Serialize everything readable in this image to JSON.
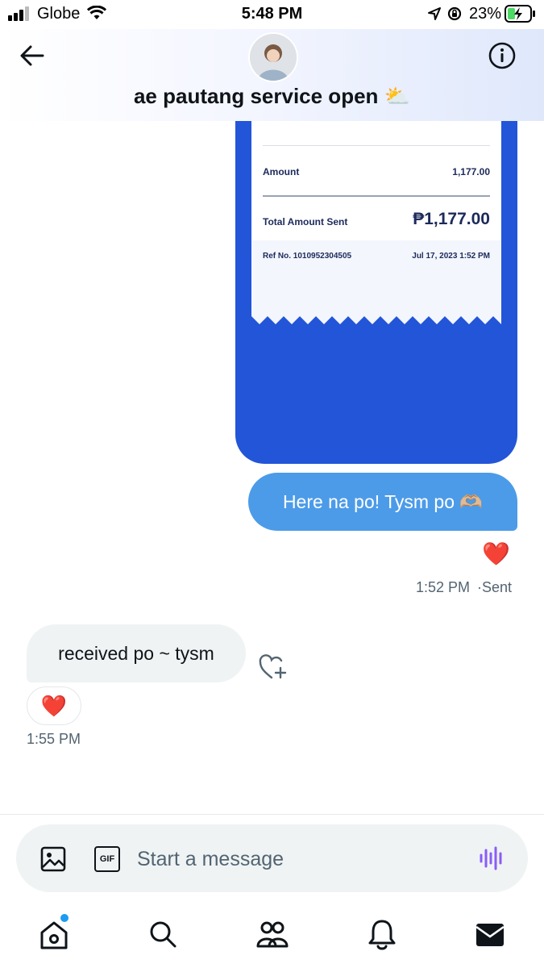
{
  "status_bar": {
    "carrier": "Globe",
    "time": "5:48 PM",
    "battery_percent": "23%"
  },
  "header": {
    "title": "ae pautang service open ⛅"
  },
  "receipt": {
    "amount_label": "Amount",
    "amount_value": "1,177.00",
    "total_label": "Total Amount Sent",
    "total_value": "₱1,177.00",
    "ref_label": "Ref No. 1010952304505",
    "ref_date": "Jul 17, 2023 1:52 PM"
  },
  "messages": {
    "sent_text": "Here na po! Tysm po 🫶🏼",
    "sent_reaction": "❤️",
    "sent_time": "1:52 PM",
    "sent_status": "·Sent",
    "received_text": "received po ~ tysm",
    "received_reaction": "❤️",
    "received_time": "1:55 PM"
  },
  "composer": {
    "placeholder": "Start a message",
    "gif_label": "GIF"
  },
  "colors": {
    "accent": "#4c9be8",
    "receipt_blue": "#2355d8",
    "voice_purple": "#8a5cf6",
    "notification_dot": "#1d9bf0"
  }
}
